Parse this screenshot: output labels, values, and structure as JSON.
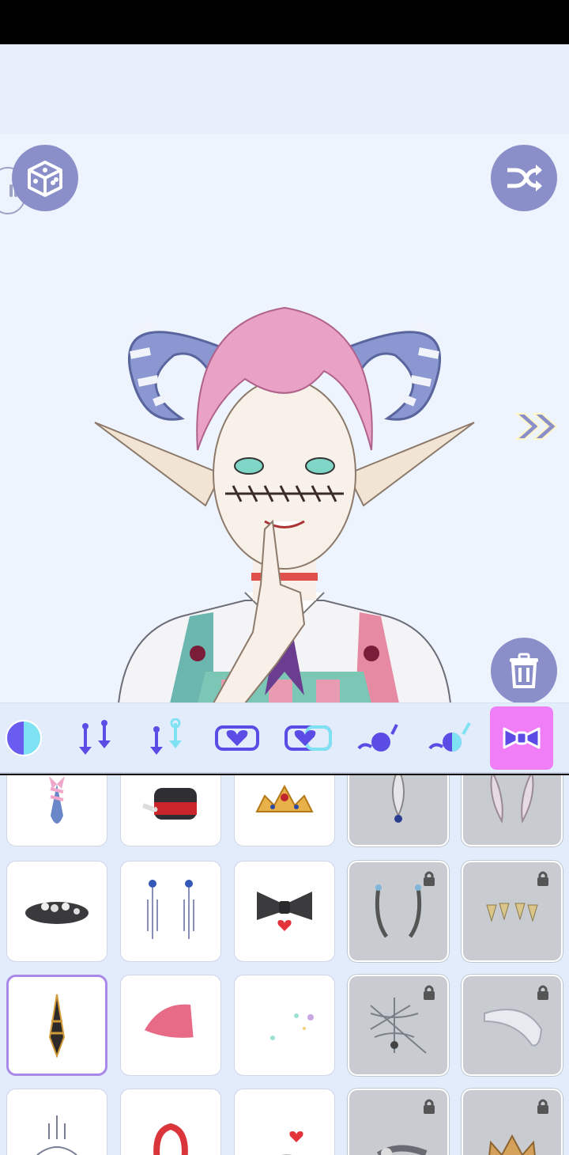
{
  "toolbar": {
    "dice_icon": "dice-icon",
    "shuffle_icon": "shuffle-icon",
    "trash_icon": "trash-icon",
    "next_icon": "double-chevron-right-icon"
  },
  "tabs": [
    {
      "name": "skin-tone",
      "active": false
    },
    {
      "name": "eyebrow-shape",
      "active": false
    },
    {
      "name": "eyebrow-color",
      "active": false
    },
    {
      "name": "eye-shape",
      "active": false
    },
    {
      "name": "eye-color",
      "active": false
    },
    {
      "name": "mouth-shape",
      "active": false
    },
    {
      "name": "mouth-color",
      "active": false
    },
    {
      "name": "accessories",
      "active": true
    }
  ],
  "items": [
    {
      "name": "ribbon-spike",
      "locked": false
    },
    {
      "name": "top-hat",
      "locked": false
    },
    {
      "name": "tiara",
      "locked": false
    },
    {
      "name": "feather-earring",
      "locked": true
    },
    {
      "name": "feather-pair",
      "locked": true
    },
    {
      "name": "flower-hat",
      "locked": false
    },
    {
      "name": "chain-earrings",
      "locked": false
    },
    {
      "name": "black-bow",
      "locked": false
    },
    {
      "name": "horn-clips",
      "locked": true
    },
    {
      "name": "teeth-gold",
      "locked": true
    },
    {
      "name": "spike-ornament",
      "locked": false,
      "selected": true
    },
    {
      "name": "santa-hat",
      "locked": false
    },
    {
      "name": "sparkles",
      "locked": false
    },
    {
      "name": "spider-web",
      "locked": true
    },
    {
      "name": "white-beret",
      "locked": true
    },
    {
      "name": "chandelier-earring",
      "locked": false
    },
    {
      "name": "red-hood",
      "locked": false
    },
    {
      "name": "hearts",
      "locked": false
    },
    {
      "name": "skull-ribbon",
      "locked": true
    },
    {
      "name": "gold-crown",
      "locked": true
    }
  ]
}
